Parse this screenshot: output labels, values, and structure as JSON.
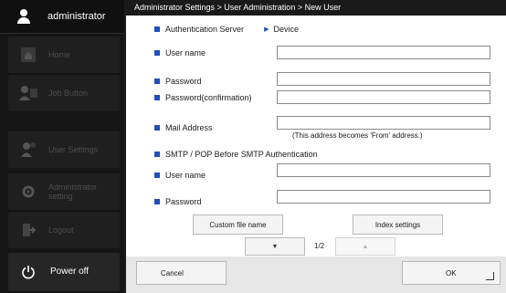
{
  "sidebar": {
    "user": "administrator",
    "items": [
      {
        "label": "Home",
        "icon": "home-icon"
      },
      {
        "label": "Job Button",
        "icon": "job-button-icon"
      },
      {
        "label": "User Settings",
        "icon": "user-settings-icon"
      },
      {
        "label": "Administrator setting",
        "icon": "gear-icon"
      },
      {
        "label": "Logout",
        "icon": "logout-icon"
      },
      {
        "label": "Power off",
        "icon": "power-icon"
      }
    ]
  },
  "main": {
    "breadcrumb": "Administrator Settings > User Administration > New User",
    "auth_server_label": "Authentication Server",
    "auth_server_value": "Device",
    "fields": {
      "user_name": "User name",
      "password": "Password",
      "password_confirm": "Password(confirmation)",
      "mail_address": "Mail Address",
      "mail_note": "(This address becomes 'From' address.)"
    },
    "smtp_section": "SMTP / POP Before SMTP Authentication",
    "smtp_user_name": "User name",
    "smtp_password": "Password",
    "custom_file_name": "Custom file name",
    "index_settings": "Index settings",
    "page_indicator": "1/2",
    "cancel": "Cancel",
    "ok": "OK"
  },
  "colors": {
    "accent_blue": "#1f4fb8",
    "sidebar_bg": "#151515",
    "titlebar_bg": "#1a1a1a"
  }
}
